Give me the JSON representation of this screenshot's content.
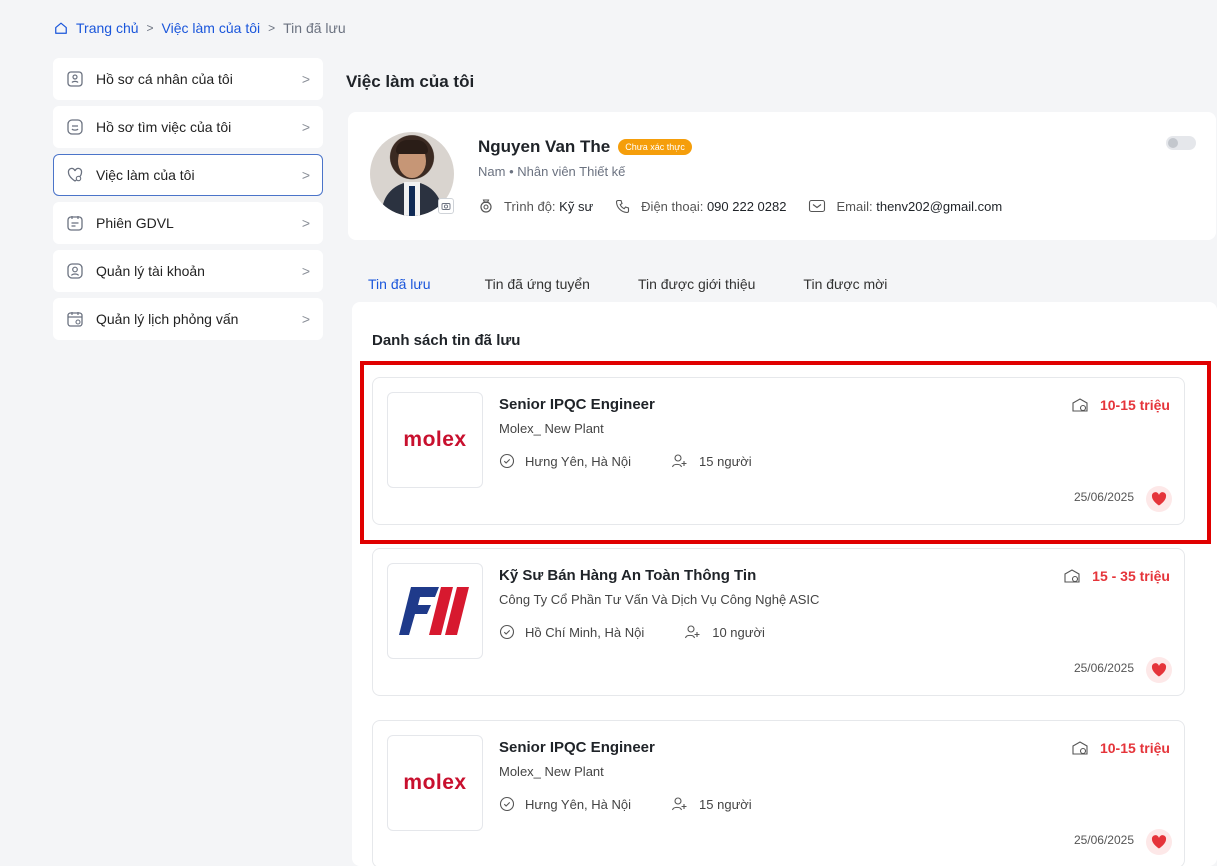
{
  "breadcrumb": {
    "home": "Trang chủ",
    "parent": "Việc làm của tôi",
    "current": "Tin đã lưu"
  },
  "sidebar": {
    "items": [
      {
        "label": "Hồ sơ cá nhân của tôi",
        "icon": "id-card-icon"
      },
      {
        "label": "Hồ sơ tìm việc của tôi",
        "icon": "resume-icon"
      },
      {
        "label": "Việc làm của tôi",
        "icon": "heart-job-icon"
      },
      {
        "label": "Phiên GDVL",
        "icon": "calendar-note-icon"
      },
      {
        "label": "Quản lý tài khoản",
        "icon": "user-icon"
      },
      {
        "label": "Quản lý lịch phỏng vấn",
        "icon": "calendar-icon"
      }
    ],
    "active_index": 2
  },
  "main": {
    "title": "Việc làm của tôi"
  },
  "profile": {
    "name": "Nguyen Van The",
    "badge": "Chưa xác thực",
    "gender": "Nam",
    "role": "Nhân viên Thiết kế",
    "education_label": "Trình độ:",
    "education_value": "Kỹ sư",
    "phone_label": "Điện thoại:",
    "phone_value": "090 222 0282",
    "email_label": "Email:",
    "email_value": "thenv202@gmail.com"
  },
  "tabs": [
    {
      "label": "Tin đã lưu",
      "active": true
    },
    {
      "label": "Tin đã ứng tuyển",
      "active": false
    },
    {
      "label": "Tin được giới thiệu",
      "active": false
    },
    {
      "label": "Tin được mời",
      "active": false
    }
  ],
  "list": {
    "title": "Danh sách tin đã lưu",
    "jobs": [
      {
        "title": "Senior IPQC Engineer",
        "company": "Molex_ New Plant",
        "location": "Hưng Yên, Hà Nội",
        "count": "15 người",
        "salary": "10-15 triệu",
        "date": "25/06/2025",
        "logo": "molex"
      },
      {
        "title": "Kỹ Sư Bán Hàng An Toàn Thông Tin",
        "company": "Công Ty Cổ Phần Tư Vấn Và Dịch Vụ Công Nghệ ASIC",
        "location": "Hồ Chí Minh, Hà Nội",
        "count": "10 người",
        "salary": "15 - 35 triệu",
        "date": "25/06/2025",
        "logo": "fii"
      },
      {
        "title": "Senior IPQC Engineer",
        "company": "Molex_ New Plant",
        "location": "Hưng Yên, Hà Nội",
        "count": "15 người",
        "salary": "10-15 triệu",
        "date": "25/06/2025",
        "logo": "molex"
      }
    ]
  },
  "colors": {
    "accent": "#1a56db",
    "salary": "#e5343a",
    "badge": "#f59e0b",
    "highlight": "#e00000"
  }
}
